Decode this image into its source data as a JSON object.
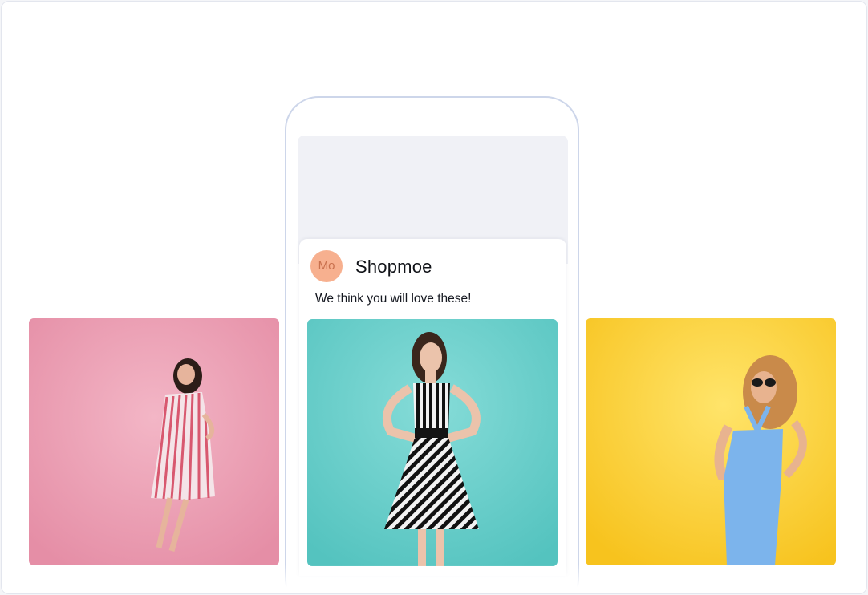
{
  "brand": {
    "avatar_initials": "Mo",
    "name": "Shopmoe",
    "avatar_color": "#f7b08f"
  },
  "message": {
    "text": "We think you will love these!"
  },
  "products": [
    {
      "name": "product-photo-pink-striped-dress",
      "background": "#ec9fb4"
    },
    {
      "name": "product-photo-black-white-striped-dress",
      "background": "#6fcfcb"
    },
    {
      "name": "product-photo-blue-bodycon-dress",
      "background": "#fbd23e"
    }
  ]
}
